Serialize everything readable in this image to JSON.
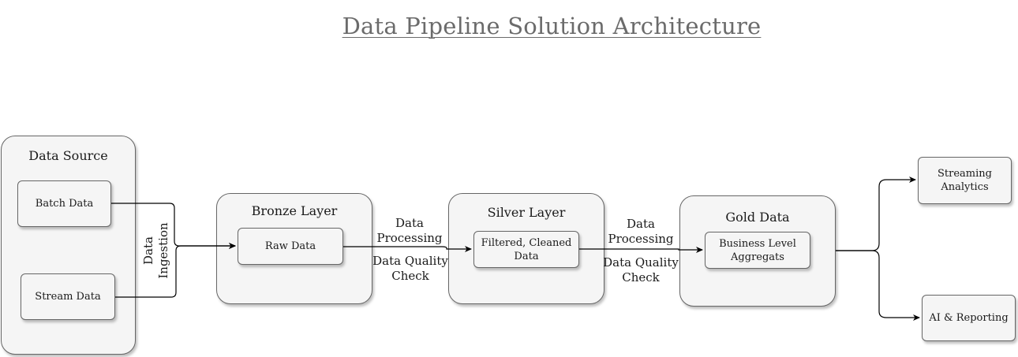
{
  "title": "Data Pipeline Solution Architecture",
  "containers": {
    "data_source": "Data Source",
    "bronze": "Bronze Layer",
    "silver": "Silver Layer",
    "gold": "Gold Data"
  },
  "nodes": {
    "batch": "Batch Data",
    "stream": "Stream Data",
    "raw": "Raw Data",
    "filtered": "Filtered, Cleaned\nData",
    "business": "Business Level\nAggregats",
    "streaming_analytics": "Streaming\nAnalytics",
    "ai_reporting": "AI & Reporting"
  },
  "edge_labels": {
    "ingestion": "Data\nIngestion",
    "processing_1": "Data\nProcessing",
    "quality_1": "Data Quality\nCheck",
    "processing_2": "Data\nProcessing",
    "quality_2": "Data Quality\nCheck"
  }
}
